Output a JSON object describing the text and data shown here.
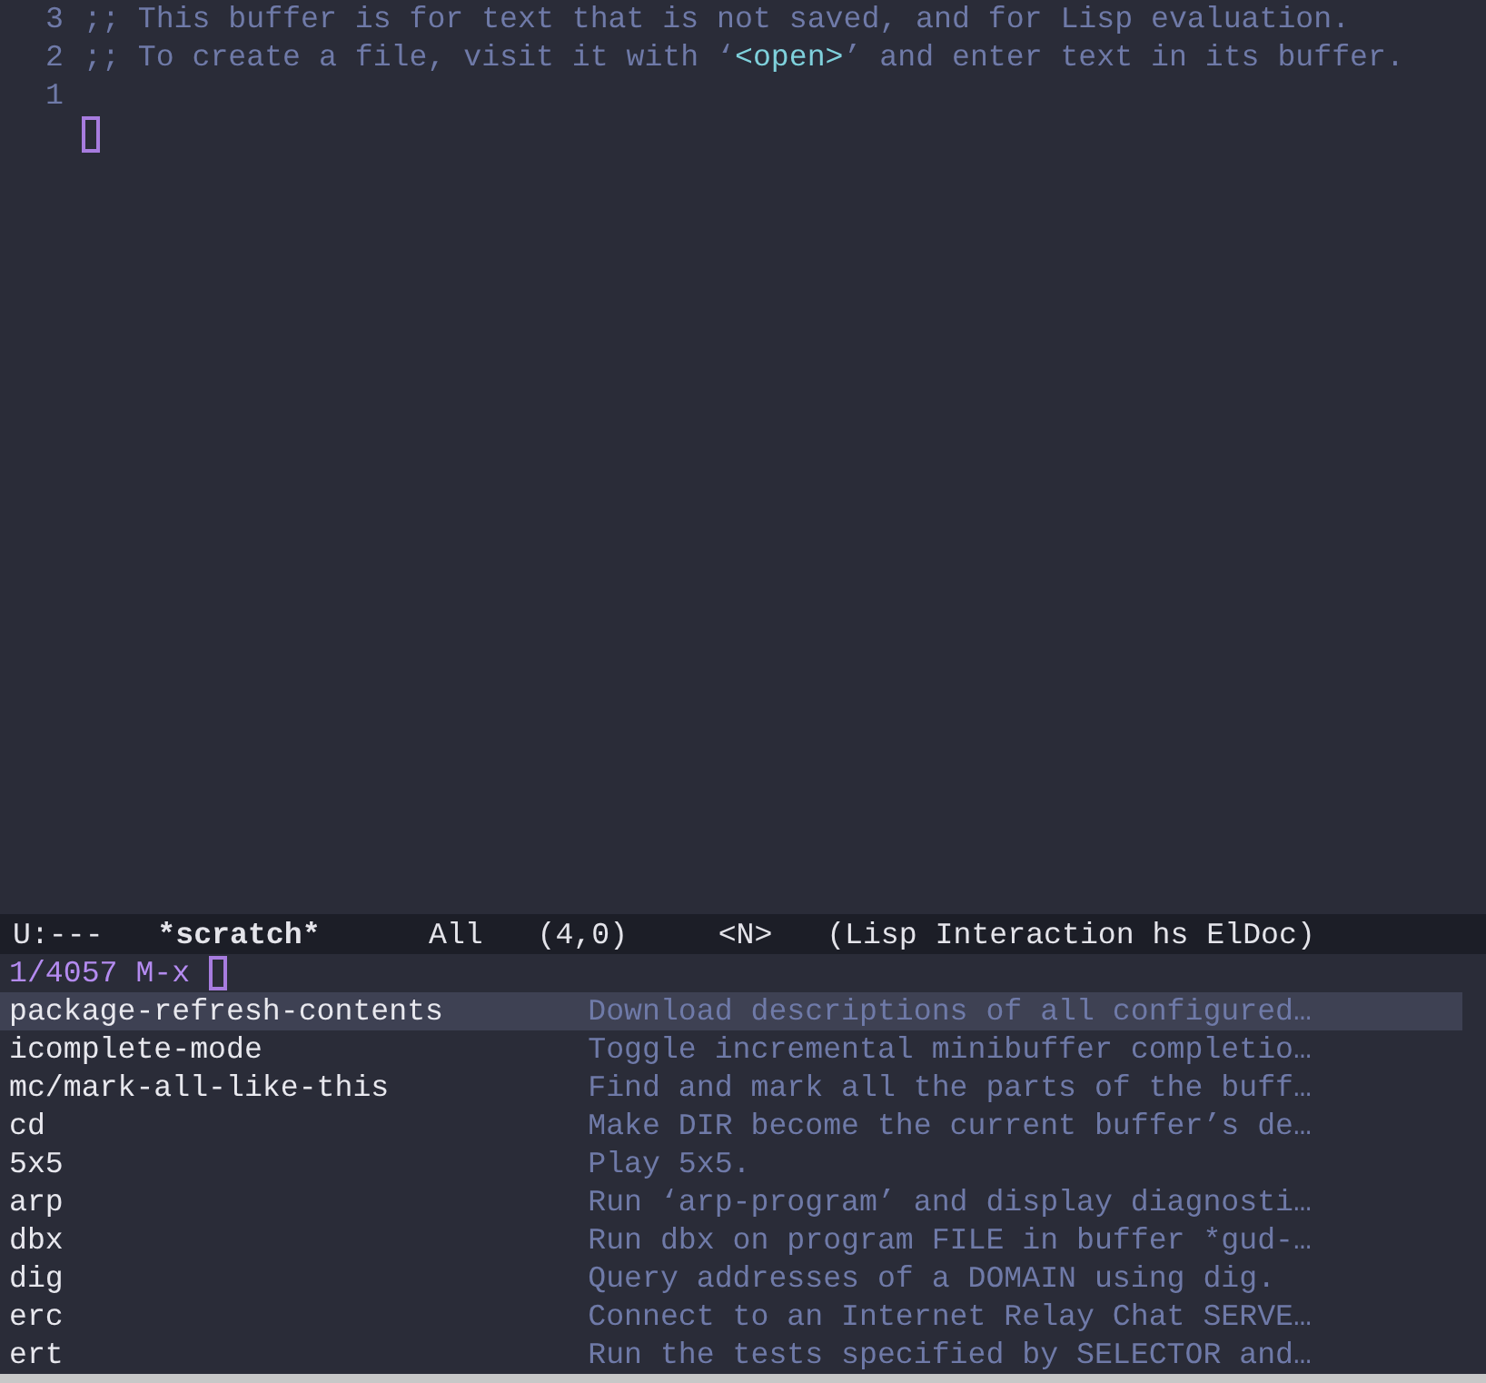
{
  "buffer": {
    "lines": [
      {
        "number": "3",
        "segments": [
          {
            "text": ";; This buffer is for text that is not saved, and for Lisp evaluation.",
            "kind": "comment"
          }
        ]
      },
      {
        "number": "2",
        "segments": [
          {
            "text": ";; To create a file, visit it with ‘",
            "kind": "comment"
          },
          {
            "text": "<open>",
            "kind": "key"
          },
          {
            "text": "’ and enter text in its buffer.",
            "kind": "comment"
          }
        ]
      },
      {
        "number": "1"
      }
    ]
  },
  "mode_line": {
    "state": "U:---",
    "buffer_name": "*scratch*",
    "position": "All",
    "cursor": "(4,0)",
    "evil_state": "<N>",
    "modes": "(Lisp Interaction hs ElDoc)"
  },
  "minibuffer": {
    "count": "1/4057",
    "prompt": "M-x"
  },
  "candidates": [
    {
      "command": "package-refresh-contents",
      "description": "Download descriptions of all configured…",
      "selected": true
    },
    {
      "command": "icomplete-mode",
      "description": "Toggle incremental minibuffer completio…",
      "selected": false
    },
    {
      "command": "mc/mark-all-like-this",
      "description": "Find and mark all the parts of the buff…",
      "selected": false
    },
    {
      "command": "cd",
      "description": "Make DIR become the current buffer’s de…",
      "selected": false
    },
    {
      "command": "5x5",
      "description": "Play 5x5.",
      "selected": false
    },
    {
      "command": "arp",
      "description": "Run ‘arp-program’ and display diagnosti…",
      "selected": false
    },
    {
      "command": "dbx",
      "description": "Run dbx on program FILE in buffer *gud-…",
      "selected": false
    },
    {
      "command": "dig",
      "description": "Query addresses of a DOMAIN using dig.",
      "selected": false
    },
    {
      "command": "erc",
      "description": "Connect to an Internet Relay Chat SERVE…",
      "selected": false
    },
    {
      "command": "ert",
      "description": "Run the tests specified by SELECTOR and…",
      "selected": false
    }
  ]
}
